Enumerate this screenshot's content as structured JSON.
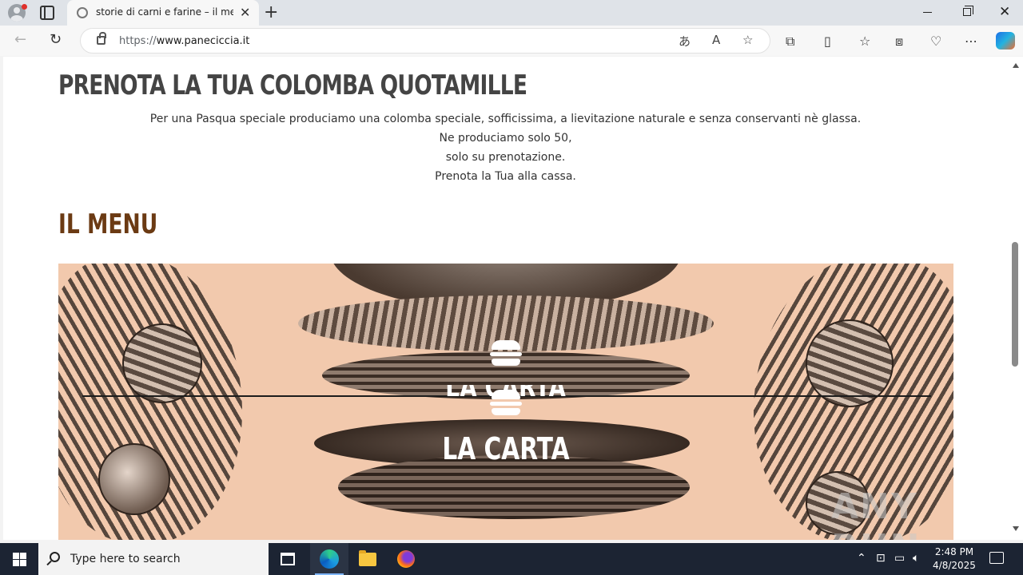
{
  "browser": {
    "tab": {
      "title": "storie di carni e farine – il menu d"
    },
    "address": {
      "scheme": "https://",
      "host": "www.paneciccia.it"
    }
  },
  "page": {
    "headline": "PRENOTA LA TUA COLOMBA QUOTAMILLE",
    "description": [
      "Per una Pasqua speciale produciamo una colomba speciale, sofficissima, a lievitazione naturale e senza conservanti nè glassa.",
      "Ne produciamo solo 50,",
      "solo su prenotazione.",
      "Prenota la Tua alla cassa."
    ],
    "menu_heading": "IL MENU",
    "card": {
      "title": "LA CARTA",
      "ghost_title": "LA CARTA"
    }
  },
  "watermark": "ANY RUN",
  "taskbar": {
    "search_placeholder": "Type here to search",
    "time": "2:48 PM",
    "date": "4/8/2025"
  },
  "colors": {
    "headline": "#444444",
    "menu_heading": "#6b3a13",
    "banner_bg": "#f2c9ad",
    "taskbar": "#1c2433"
  }
}
